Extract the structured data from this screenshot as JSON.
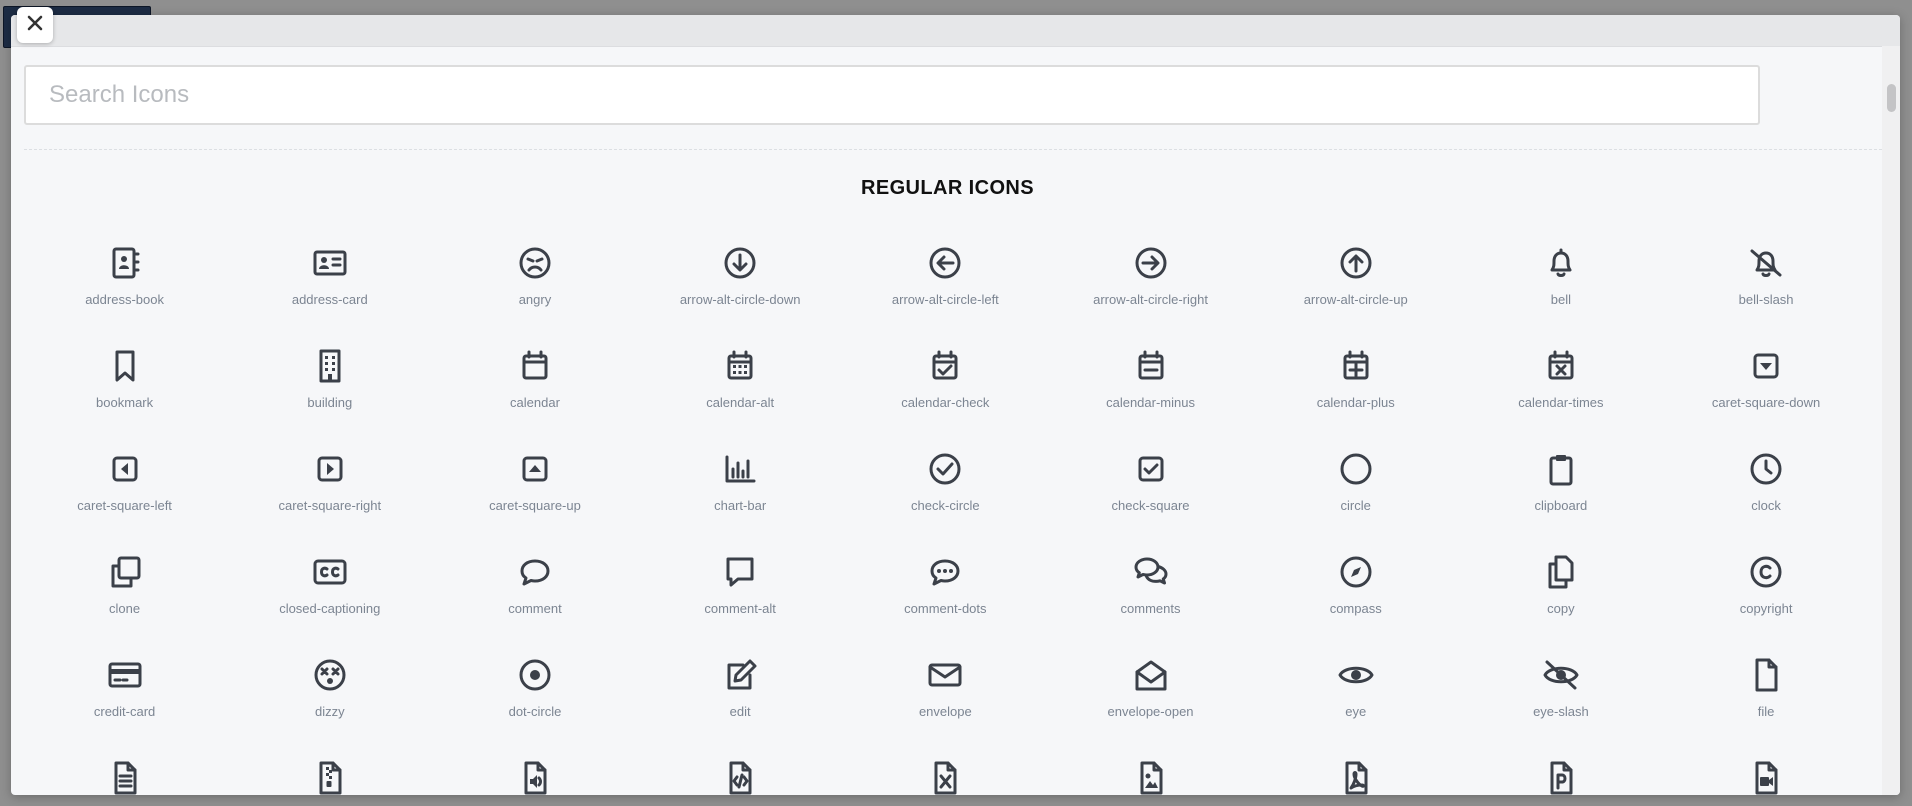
{
  "search": {
    "placeholder": "Search Icons",
    "value": ""
  },
  "section": {
    "title": "REGULAR ICONS"
  },
  "icons": [
    {
      "label": "address-book",
      "icon": "address-book-icon"
    },
    {
      "label": "address-card",
      "icon": "address-card-icon"
    },
    {
      "label": "angry",
      "icon": "angry-icon"
    },
    {
      "label": "arrow-alt-circle-down",
      "icon": "arrow-alt-circle-down-icon"
    },
    {
      "label": "arrow-alt-circle-left",
      "icon": "arrow-alt-circle-left-icon"
    },
    {
      "label": "arrow-alt-circle-right",
      "icon": "arrow-alt-circle-right-icon"
    },
    {
      "label": "arrow-alt-circle-up",
      "icon": "arrow-alt-circle-up-icon"
    },
    {
      "label": "bell",
      "icon": "bell-icon"
    },
    {
      "label": "bell-slash",
      "icon": "bell-slash-icon"
    },
    {
      "label": "bookmark",
      "icon": "bookmark-icon"
    },
    {
      "label": "building",
      "icon": "building-icon"
    },
    {
      "label": "calendar",
      "icon": "calendar-icon"
    },
    {
      "label": "calendar-alt",
      "icon": "calendar-alt-icon"
    },
    {
      "label": "calendar-check",
      "icon": "calendar-check-icon"
    },
    {
      "label": "calendar-minus",
      "icon": "calendar-minus-icon"
    },
    {
      "label": "calendar-plus",
      "icon": "calendar-plus-icon"
    },
    {
      "label": "calendar-times",
      "icon": "calendar-times-icon"
    },
    {
      "label": "caret-square-down",
      "icon": "caret-square-down-icon"
    },
    {
      "label": "caret-square-left",
      "icon": "caret-square-left-icon"
    },
    {
      "label": "caret-square-right",
      "icon": "caret-square-right-icon"
    },
    {
      "label": "caret-square-up",
      "icon": "caret-square-up-icon"
    },
    {
      "label": "chart-bar",
      "icon": "chart-bar-icon"
    },
    {
      "label": "check-circle",
      "icon": "check-circle-icon"
    },
    {
      "label": "check-square",
      "icon": "check-square-icon"
    },
    {
      "label": "circle",
      "icon": "circle-icon"
    },
    {
      "label": "clipboard",
      "icon": "clipboard-icon"
    },
    {
      "label": "clock",
      "icon": "clock-icon"
    },
    {
      "label": "clone",
      "icon": "clone-icon"
    },
    {
      "label": "closed-captioning",
      "icon": "closed-captioning-icon"
    },
    {
      "label": "comment",
      "icon": "comment-icon"
    },
    {
      "label": "comment-alt",
      "icon": "comment-alt-icon"
    },
    {
      "label": "comment-dots",
      "icon": "comment-dots-icon"
    },
    {
      "label": "comments",
      "icon": "comments-icon"
    },
    {
      "label": "compass",
      "icon": "compass-icon"
    },
    {
      "label": "copy",
      "icon": "copy-icon"
    },
    {
      "label": "copyright",
      "icon": "copyright-icon"
    },
    {
      "label": "credit-card",
      "icon": "credit-card-icon"
    },
    {
      "label": "dizzy",
      "icon": "dizzy-icon"
    },
    {
      "label": "dot-circle",
      "icon": "dot-circle-icon"
    },
    {
      "label": "edit",
      "icon": "edit-icon"
    },
    {
      "label": "envelope",
      "icon": "envelope-icon"
    },
    {
      "label": "envelope-open",
      "icon": "envelope-open-icon"
    },
    {
      "label": "eye",
      "icon": "eye-icon"
    },
    {
      "label": "eye-slash",
      "icon": "eye-slash-icon"
    },
    {
      "label": "file",
      "icon": "file-icon"
    },
    {
      "label": "",
      "icon": "file-alt-icon"
    },
    {
      "label": "",
      "icon": "file-archive-icon"
    },
    {
      "label": "",
      "icon": "file-audio-icon"
    },
    {
      "label": "",
      "icon": "file-code-icon"
    },
    {
      "label": "",
      "icon": "file-excel-icon"
    },
    {
      "label": "",
      "icon": "file-image-icon"
    },
    {
      "label": "",
      "icon": "file-pdf-icon"
    },
    {
      "label": "",
      "icon": "file-powerpoint-icon"
    },
    {
      "label": "",
      "icon": "file-video-icon"
    }
  ],
  "colors": {
    "icon": "#3b4049",
    "label": "#7c8592",
    "title": "#111111",
    "background": "#f6f7f9"
  }
}
